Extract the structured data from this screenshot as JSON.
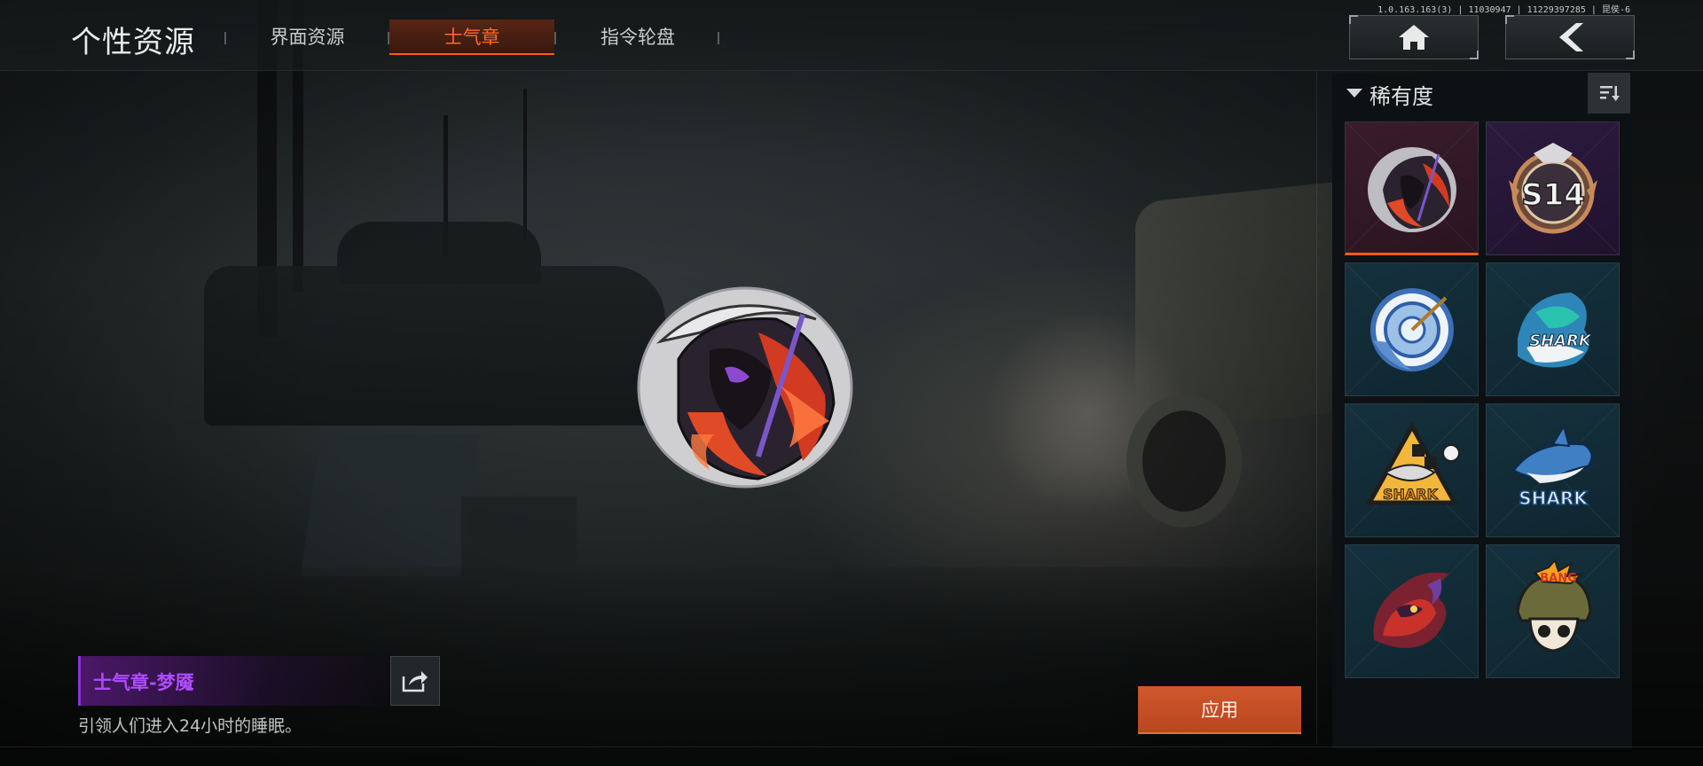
{
  "header": {
    "title": "个性资源",
    "tabs": [
      {
        "label": "界面资源",
        "active": false
      },
      {
        "label": "士气章",
        "active": true
      },
      {
        "label": "指令轮盘",
        "active": false
      }
    ],
    "version_text": "1.0.163.163(3) | 11030947 | 11229397285 | 昆侯-6",
    "home_icon": "home-icon",
    "back_icon": "chevron-left-icon"
  },
  "preview": {
    "item_name": "士气章-梦魇",
    "description": "引领人们进入24小时的睡眠。",
    "share_icon": "share-icon"
  },
  "actions": {
    "apply_label": "应用"
  },
  "panel": {
    "sort_label": "稀有度",
    "sort_icon": "sort-icon",
    "items": [
      {
        "icon": "reaper-badge-icon",
        "rarity": "legendary",
        "selected": true
      },
      {
        "icon": "s14-emblem-icon",
        "rarity": "epic",
        "selected": false
      },
      {
        "icon": "target-clock-icon",
        "rarity": "rare",
        "selected": false
      },
      {
        "icon": "shark-wave-icon",
        "rarity": "rare",
        "selected": false
      },
      {
        "icon": "shark-warning-sign-icon",
        "rarity": "rare",
        "selected": false
      },
      {
        "icon": "shark-leaping-icon",
        "rarity": "rare",
        "selected": false
      },
      {
        "icon": "flame-dragon-icon",
        "rarity": "rare",
        "selected": false
      },
      {
        "icon": "bang-helmet-skull-icon",
        "rarity": "rare",
        "selected": false
      }
    ]
  },
  "colors": {
    "accent": "#ff5a1f",
    "apply_button": "#c8502a",
    "legendary_text": "#b04cff"
  }
}
